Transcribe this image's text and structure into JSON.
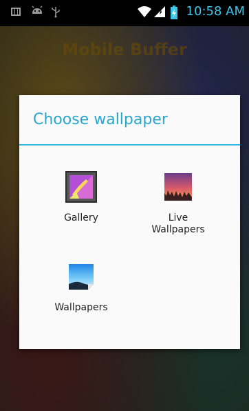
{
  "status_bar": {
    "time": "10:58 AM",
    "icons_left": [
      "sim-card-icon",
      "android-debug-icon",
      "usb-icon"
    ],
    "icons_right": [
      "wifi-icon",
      "signal-icon",
      "battery-charging-icon"
    ],
    "time_color": "#3cc6ea"
  },
  "home": {
    "title": "Mobile Buffer"
  },
  "dialog": {
    "title": "Choose wallpaper",
    "accent_color": "#33b5e5",
    "items": [
      {
        "label": "Gallery",
        "icon": "gallery-icon"
      },
      {
        "label": "Live\nWallpapers",
        "icon": "live-wallpapers-icon"
      },
      {
        "label": "Wallpapers",
        "icon": "wallpapers-icon"
      }
    ]
  }
}
